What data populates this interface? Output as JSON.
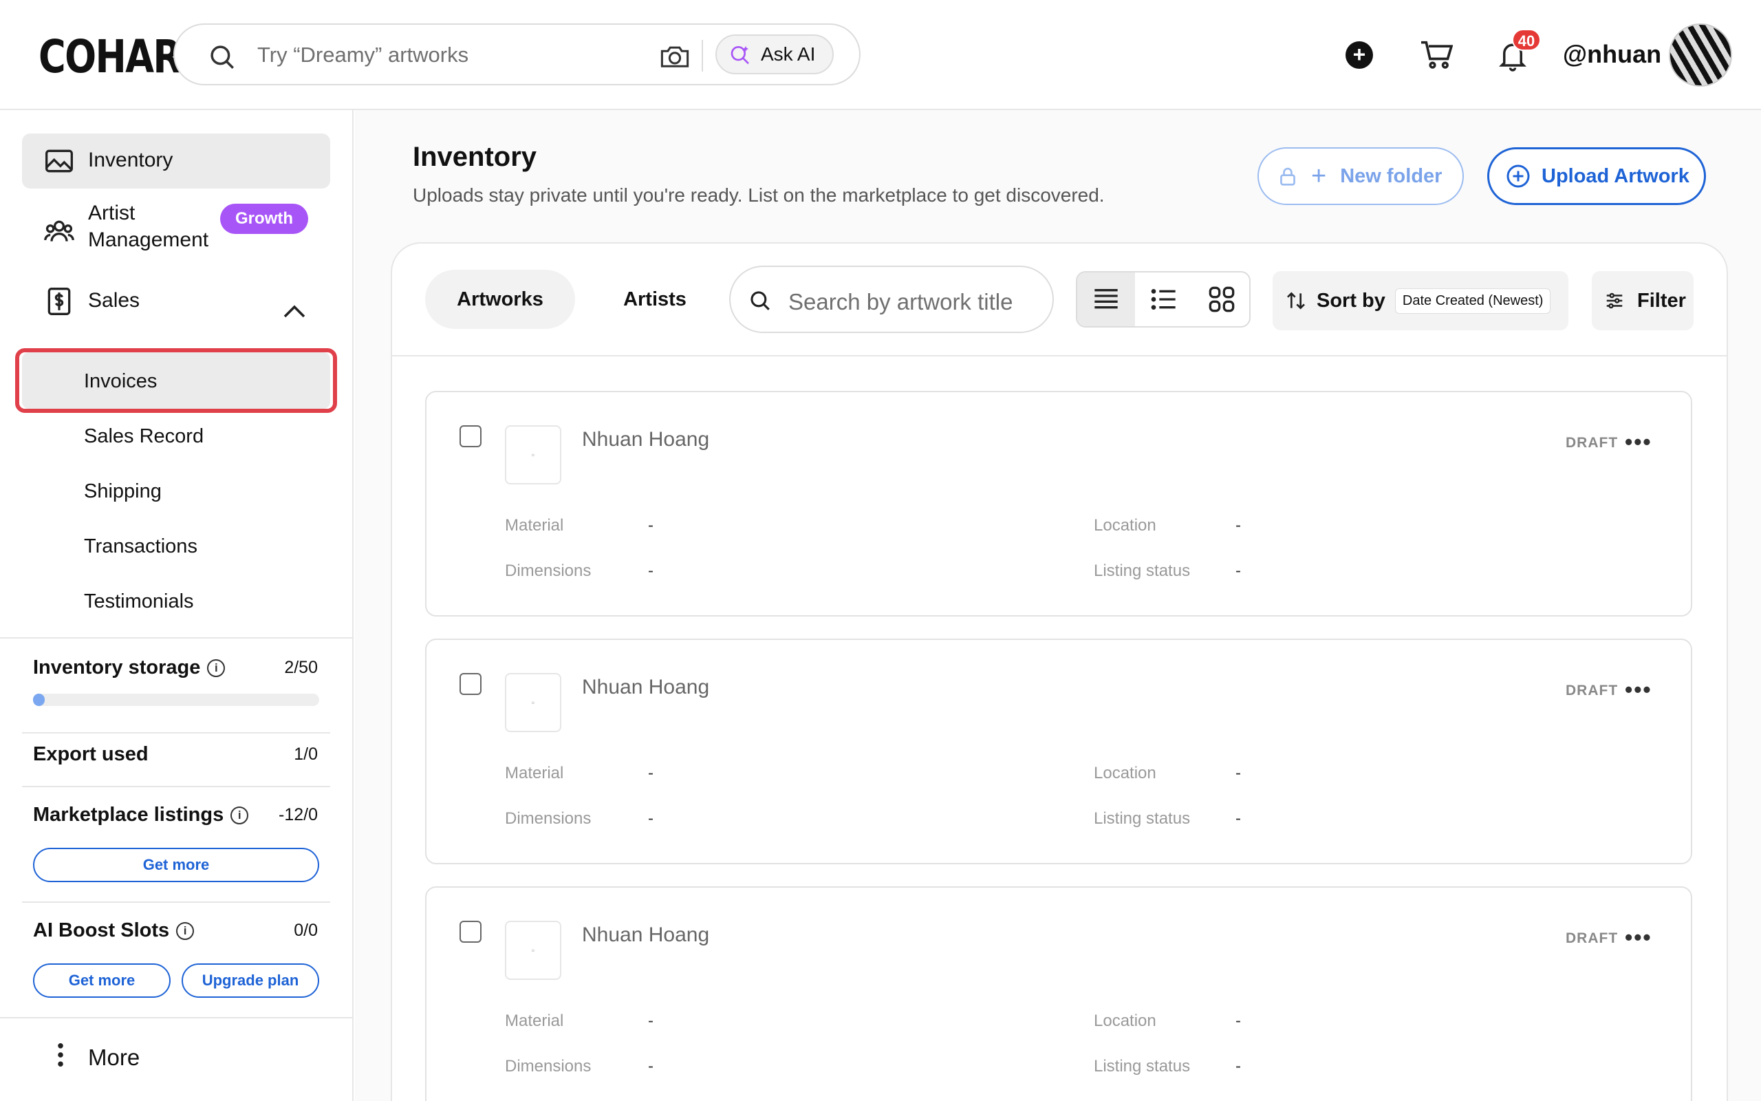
{
  "header": {
    "logo": "COHART",
    "search_placeholder": "Try “Dreamy” artworks",
    "ask_ai": "Ask AI",
    "notifications_count": "40",
    "username": "@nhuan"
  },
  "sidebar": {
    "inventory": "Inventory",
    "artist_management_line1": "Artist",
    "artist_management_line2": "Management",
    "growth_badge": "Growth",
    "sales": "Sales",
    "sub_items": [
      "Invoices",
      "Sales Record",
      "Shipping",
      "Transactions",
      "Testimonials"
    ],
    "inventory_storage_label": "Inventory storage",
    "inventory_storage_value": "2/50",
    "inventory_storage_progress": 0.04,
    "export_used_label": "Export used",
    "export_used_value": "1/0",
    "marketplace_label": "Marketplace listings",
    "marketplace_value": "-12/0",
    "get_more": "Get more",
    "ai_boost_label": "AI Boost Slots",
    "ai_boost_value": "0/0",
    "upgrade_plan": "Upgrade plan",
    "more": "More"
  },
  "main": {
    "title": "Inventory",
    "subtitle": "Uploads stay private until you're ready. List on the marketplace to get discovered.",
    "new_folder": "New folder",
    "upload": "Upload Artwork",
    "tabs": [
      "Artworks",
      "Artists"
    ],
    "search_placeholder": "Search by artwork title",
    "sort_label": "Sort by",
    "sort_value": "Date Created (Newest)",
    "filter": "Filter",
    "cards": [
      {
        "artist": "Nhuan Hoang",
        "status": "DRAFT",
        "material": "-",
        "location": "-",
        "dimensions": "-",
        "listing_status": "-"
      },
      {
        "artist": "Nhuan Hoang",
        "status": "DRAFT",
        "material": "-",
        "location": "-",
        "dimensions": "-",
        "listing_status": "-"
      },
      {
        "artist": "Nhuan Hoang",
        "status": "DRAFT",
        "material": "-",
        "location": "-",
        "dimensions": "-",
        "listing_status": "-"
      }
    ],
    "field_labels": {
      "material": "Material",
      "location": "Location",
      "dimensions": "Dimensions",
      "listing_status": "Listing status"
    }
  },
  "colors": {
    "accent_blue": "#1e63d6",
    "growth_purple": "#a855f7",
    "highlight_red": "#e0404a",
    "badge_red": "#e53935"
  }
}
